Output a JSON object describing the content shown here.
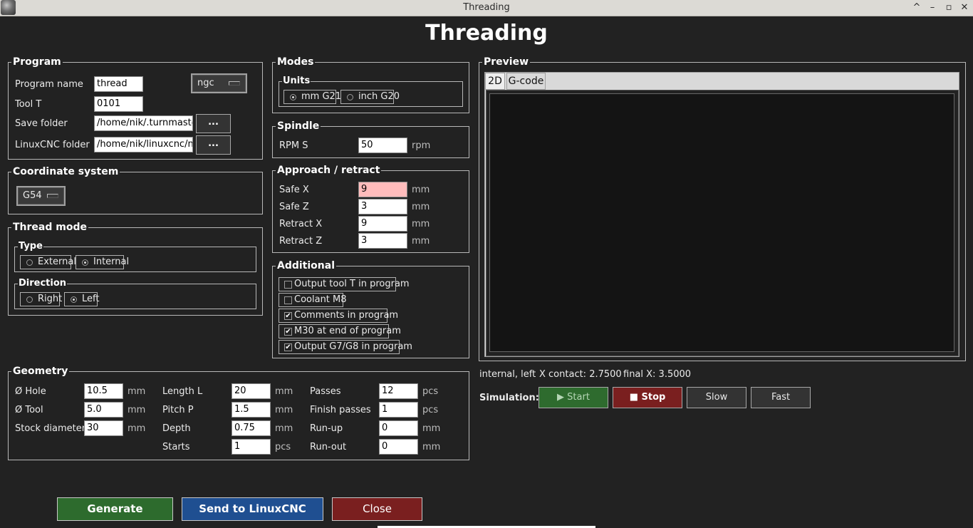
{
  "window": {
    "title": "Threading",
    "controls": [
      "^",
      "–",
      "▫",
      "✕"
    ]
  },
  "header": {
    "title": "Threading"
  },
  "program": {
    "label": "Program",
    "name_label": "Program name",
    "name_value": "thread",
    "format_value": "ngc",
    "tool_label": "Tool T",
    "tool_value": "0101",
    "save_label": "Save folder",
    "save_value": "/home/nik/.turnmaster/ge",
    "linuxcnc_label": "LinuxCNC folder",
    "linuxcnc_value": "/home/nik/linuxcnc/nc_fil",
    "browse_label": "..."
  },
  "coordinate": {
    "label": "Coordinate system",
    "value": "G54"
  },
  "thread_mode": {
    "label": "Thread mode",
    "type_label": "Type",
    "type_options": [
      "External",
      "Internal"
    ],
    "type_selected": "Internal",
    "direction_label": "Direction",
    "direction_options": [
      "Right",
      "Left"
    ],
    "direction_selected": "Left"
  },
  "modes": {
    "label": "Modes",
    "units_label": "Units",
    "units_options": [
      "mm G21",
      "inch G20"
    ],
    "units_selected": "mm G21"
  },
  "spindle": {
    "label": "Spindle",
    "rpm_label": "RPM S",
    "rpm_value": "50",
    "rpm_unit": "rpm"
  },
  "approach": {
    "label": "Approach / retract",
    "unit": "mm",
    "fields": [
      {
        "label": "Safe X",
        "value": "9"
      },
      {
        "label": "Safe Z",
        "value": "3"
      },
      {
        "label": "Retract X",
        "value": "9"
      },
      {
        "label": "Retract Z",
        "value": "3"
      }
    ]
  },
  "additional": {
    "label": "Additional",
    "options": [
      {
        "label": "Output tool T in program",
        "checked": false
      },
      {
        "label": "Coolant M8",
        "checked": false
      },
      {
        "label": "Comments in program",
        "checked": true
      },
      {
        "label": "M30 at end of program",
        "checked": true
      },
      {
        "label": "Output G7/G8 in program",
        "checked": true
      }
    ]
  },
  "geometry": {
    "label": "Geometry",
    "hole_label": "Ø Hole",
    "hole_value": "10.5",
    "hole_unit": "mm",
    "tool_label": "Ø Tool",
    "tool_value": "5.0",
    "tool_unit": "mm",
    "stock_label": "Stock diameter",
    "stock_value": "30",
    "stock_unit": "mm",
    "length_label": "Length L",
    "length_value": "20",
    "length_unit": "mm",
    "pitch_label": "Pitch P",
    "pitch_value": "1.5",
    "pitch_unit": "mm",
    "depth_label": "Depth",
    "depth_value": "0.75",
    "depth_unit": "mm",
    "starts_label": "Starts",
    "starts_value": "1",
    "starts_unit": "pcs",
    "passes_label": "Passes",
    "passes_value": "12",
    "passes_unit": "pcs",
    "finish_label": "Finish passes",
    "finish_value": "1",
    "finish_unit": "pcs",
    "runup_label": "Run-up",
    "runup_value": "0",
    "runup_unit": "mm",
    "runout_label": "Run-out",
    "runout_value": "0",
    "runout_unit": "mm"
  },
  "preview": {
    "label": "Preview",
    "tabs": [
      "2D",
      "G-code"
    ],
    "active_tab": "2D",
    "status_mode": "internal, left",
    "status_contact": "X contact: 2.7500",
    "status_final": "final X: 3.5000",
    "canvas_color": "#141414"
  },
  "simulation": {
    "label": "Simulation:",
    "start_label": "▶ Start",
    "stop_label": "■ Stop",
    "slow_label": "Slow",
    "fast_label": "Fast",
    "start_color": "#2e6b2e",
    "stop_color": "#7a1f1f"
  },
  "actions": {
    "generate_label": "Generate",
    "send_label": "Send to LinuxCNC",
    "close_label": "Close",
    "generate_color": "#2d6b2d",
    "send_color": "#1f4f91",
    "close_color": "#7a1f1f"
  }
}
